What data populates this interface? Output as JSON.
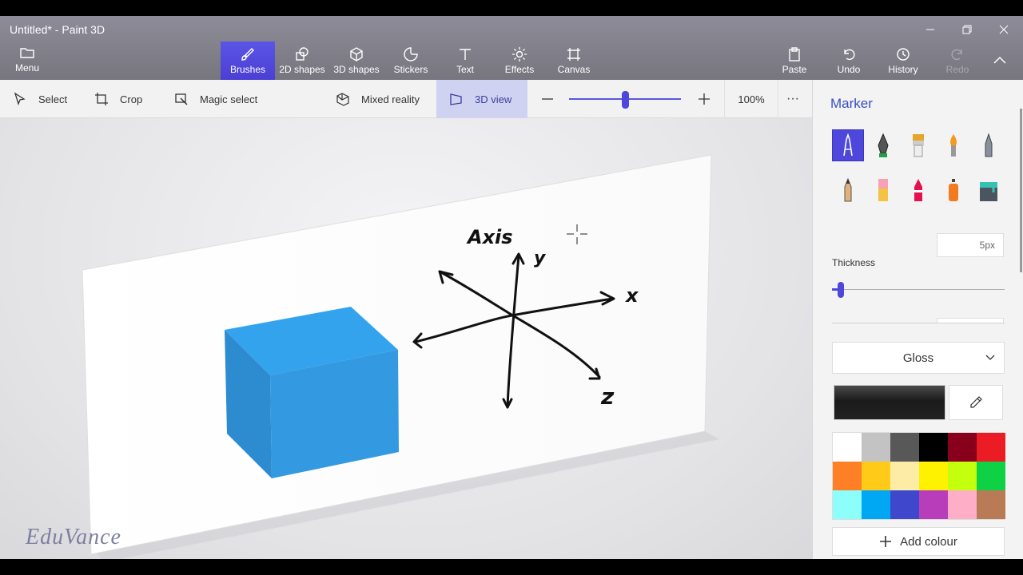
{
  "window": {
    "title": "Untitled* - Paint 3D"
  },
  "ribbon": {
    "menu_label": "Menu",
    "tools": [
      {
        "label": "Brushes",
        "icon": "brush-icon"
      },
      {
        "label": "2D shapes",
        "icon": "2d-shapes-icon"
      },
      {
        "label": "3D shapes",
        "icon": "3d-shapes-icon"
      },
      {
        "label": "Stickers",
        "icon": "stickers-icon"
      },
      {
        "label": "Text",
        "icon": "text-icon"
      },
      {
        "label": "Effects",
        "icon": "effects-icon"
      },
      {
        "label": "Canvas",
        "icon": "canvas-icon"
      }
    ],
    "actions": [
      {
        "label": "Paste",
        "icon": "paste-icon"
      },
      {
        "label": "Undo",
        "icon": "undo-icon"
      },
      {
        "label": "History",
        "icon": "history-icon"
      },
      {
        "label": "Redo",
        "icon": "redo-icon"
      }
    ]
  },
  "toolbar": {
    "select_label": "Select",
    "crop_label": "Crop",
    "magic_select_label": "Magic select",
    "mixed_reality_label": "Mixed reality",
    "view3d_label": "3D view",
    "zoom_value": "100%",
    "zoom_level": 0.5,
    "more": "···"
  },
  "canvas": {
    "handwriting": {
      "title": "Axis",
      "y": "y",
      "x": "x",
      "z": "z"
    },
    "watermark": "EduVance",
    "cube_color": "#33a3ee"
  },
  "panel": {
    "title": "Marker",
    "thickness_label": "Thickness",
    "thickness_value": "5px",
    "thickness_level": 0.05,
    "finish": "Gloss",
    "current_color": "#1a1a1a",
    "add_colour_label": "Add colour",
    "palette": [
      "#ffffff",
      "#c3c3c3",
      "#585858",
      "#000000",
      "#88001b",
      "#ec1c24",
      "#ff7f27",
      "#ffca18",
      "#fdeca6",
      "#fff200",
      "#c4ff0e",
      "#0ed145",
      "#8cfffb",
      "#00a8f3",
      "#3f48cc",
      "#b83dba",
      "#ffaec8",
      "#b97a56"
    ]
  },
  "colors": {
    "accent": "#4d48db",
    "ribbon": "#85848f"
  }
}
